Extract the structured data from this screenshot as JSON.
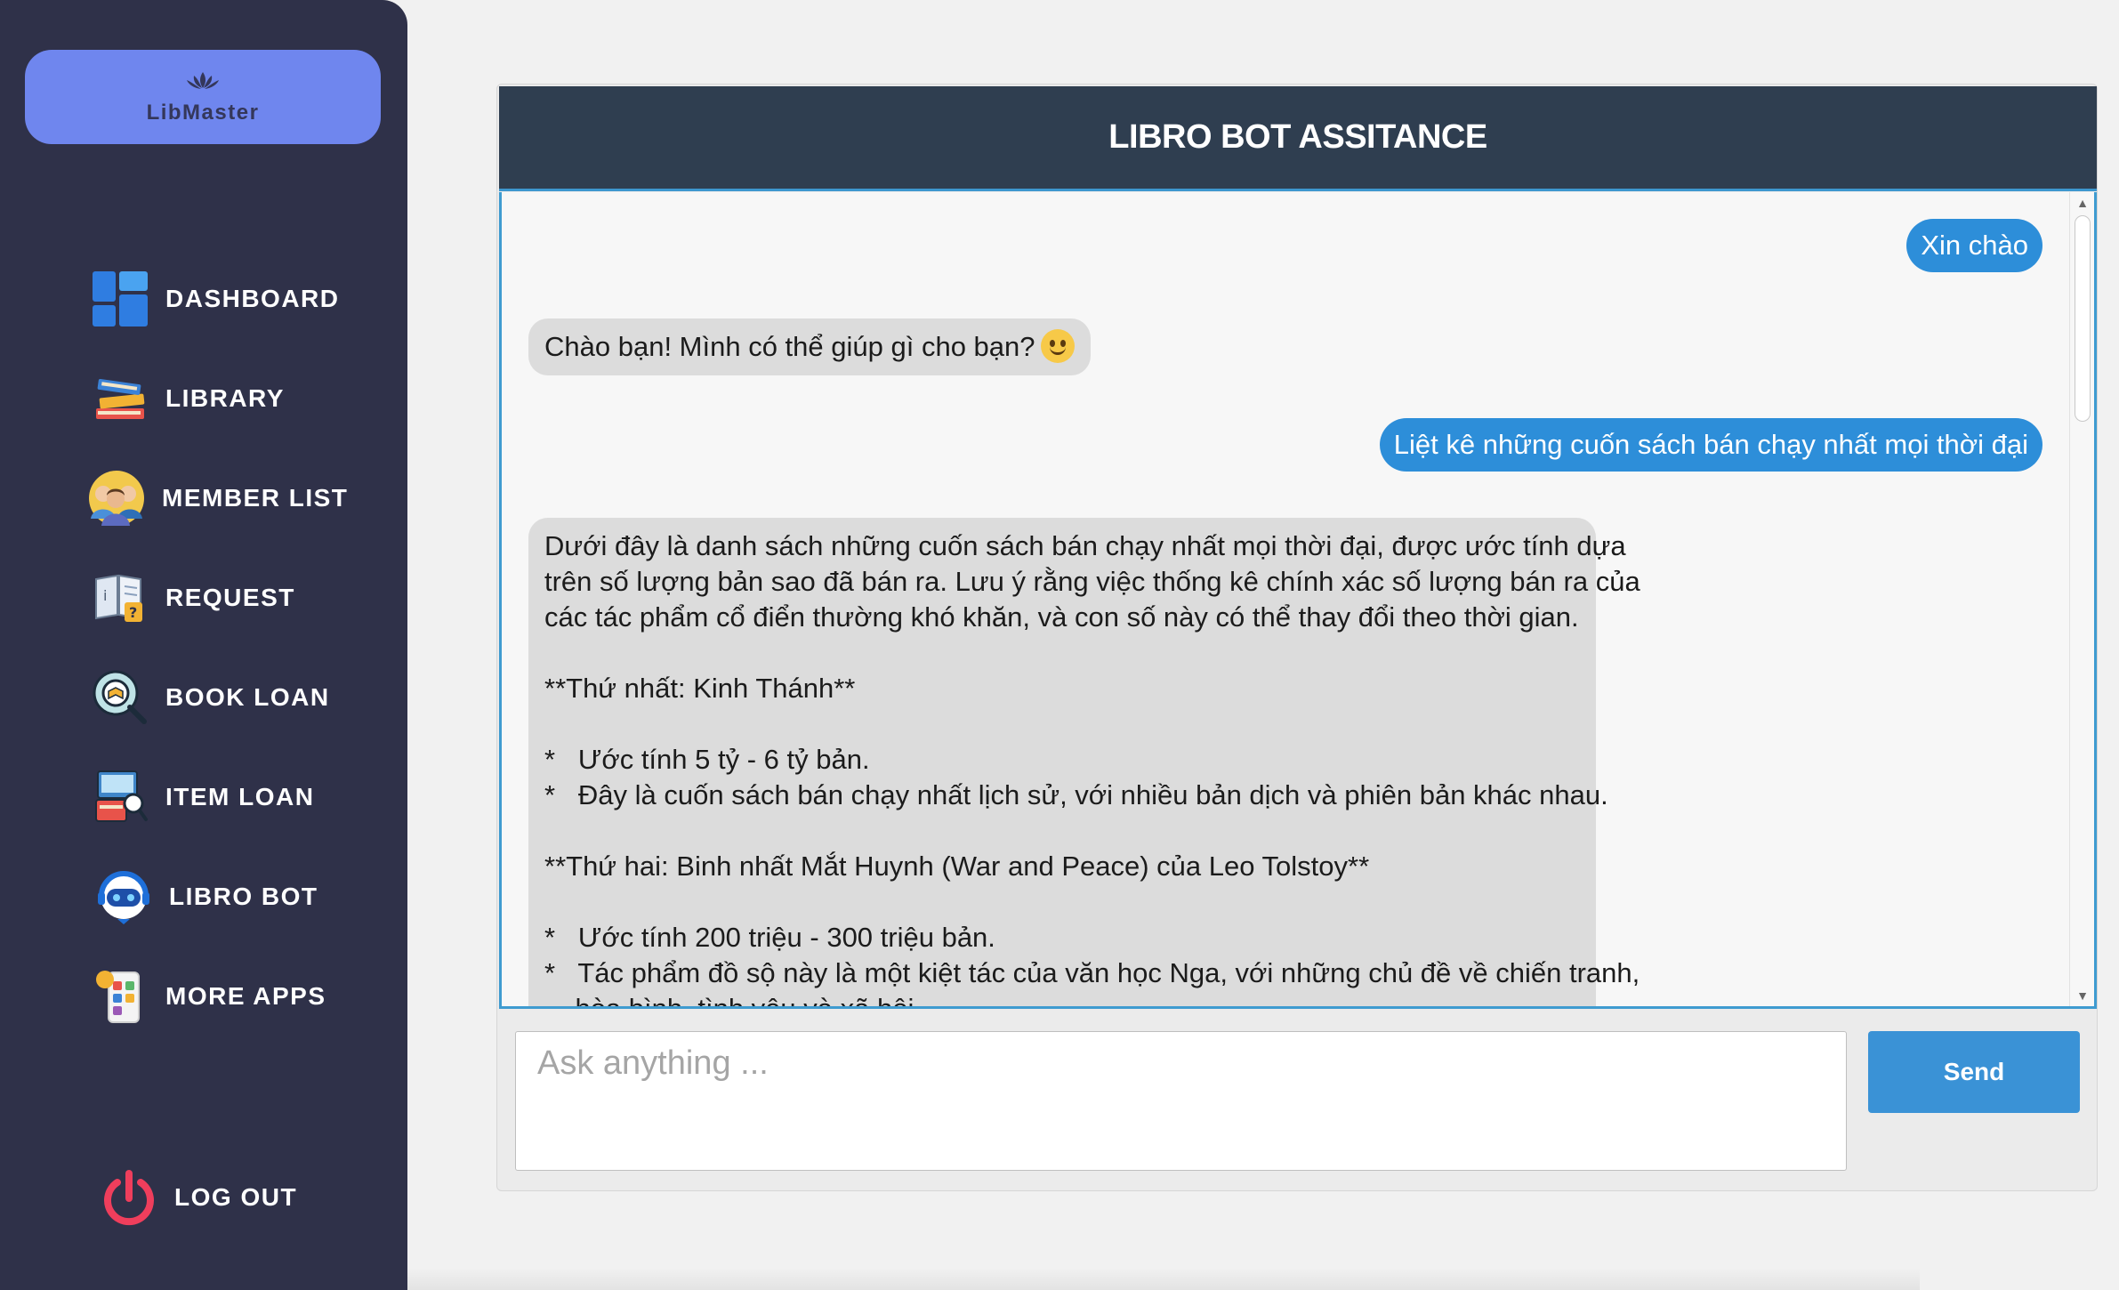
{
  "app": {
    "logo_text": "LibMaster"
  },
  "sidebar": {
    "items": [
      {
        "label": "DASHBOARD",
        "icon": "dashboard-icon"
      },
      {
        "label": "LIBRARY",
        "icon": "books-icon"
      },
      {
        "label": "MEMBER LIST",
        "icon": "members-icon"
      },
      {
        "label": "REQUEST",
        "icon": "request-icon"
      },
      {
        "label": "BOOK LOAN",
        "icon": "book-loan-icon"
      },
      {
        "label": "ITEM LOAN",
        "icon": "item-loan-icon"
      },
      {
        "label": "LIBRO BOT",
        "icon": "robot-icon"
      },
      {
        "label": "MORE APPS",
        "icon": "apps-icon"
      }
    ],
    "logout_label": "LOG OUT"
  },
  "chat": {
    "title": "LIBRO BOT ASSITANCE",
    "messages": [
      {
        "role": "user",
        "text": "Xin chào"
      },
      {
        "role": "bot",
        "text": "Chào bạn! Mình có thể giúp gì cho bạn?"
      },
      {
        "role": "user",
        "text": "Liệt kê những cuốn sách bán chạy nhất mọi thời đại"
      },
      {
        "role": "bot",
        "lines": [
          "Dưới đây là danh sách những cuốn sách bán chạy nhất mọi thời đại, được ước tính dựa",
          "trên số lượng bản sao đã bán ra. Lưu ý rằng việc thống kê chính xác số lượng bán ra của",
          "các tác phẩm cổ điển thường khó khăn, và con số này có thể thay đổi theo thời gian.",
          "",
          "**Thứ nhất: Kinh Thánh**",
          "",
          "*   Ước tính 5 tỷ - 6 tỷ bản.",
          "*   Đây là cuốn sách bán chạy nhất lịch sử, với nhiều bản dịch và phiên bản khác nhau.",
          "",
          "**Thứ hai: Binh nhất Mắt Huynh (War and Peace) của Leo Tolstoy**",
          "",
          "*   Ước tính 200 triệu - 300 triệu bản.",
          "*   Tác phẩm đồ sộ này là một kiệt tác của văn học Nga, với những chủ đề về chiến tranh,",
          "    hòa bình, tình yêu và xã hội."
        ]
      }
    ],
    "input_placeholder": "Ask anything ...",
    "input_value": "",
    "send_label": "Send"
  },
  "colors": {
    "sidebar_bg": "#2f3149",
    "logo_bg": "#6f86ee",
    "header_bg": "#2f3e50",
    "user_bubble": "#2d8ed9",
    "bot_bubble": "#dcdcdc",
    "send_button": "#3a92d6"
  }
}
